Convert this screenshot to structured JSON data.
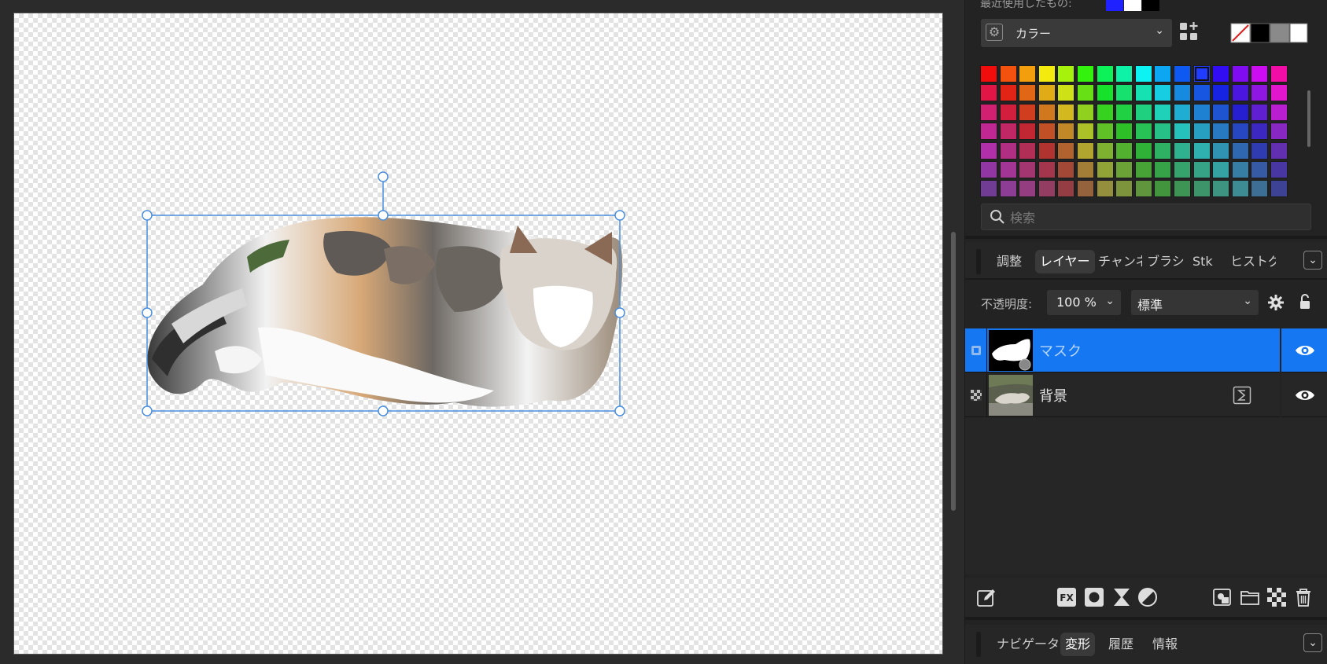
{
  "panel": {
    "recent_label": "最近使用したもの:",
    "recent_colors": [
      "#1f22ff",
      "#ffffff",
      "#000000"
    ],
    "palette_select_label": "カラー",
    "fg_bg_colors": [
      "#ffffff",
      "#000000",
      "#8a8a8a",
      "#ffffff"
    ],
    "search_placeholder": "検索",
    "selected_color": "#1f3cff"
  },
  "tabs_top": [
    "調整",
    "レイヤー",
    "チャンネル",
    "ブラシ",
    "Stk",
    "ヒストグラム"
  ],
  "tabs_top_active": "レイヤー",
  "opacity": {
    "label": "不透明度:",
    "value": "100 %",
    "blend_mode": "標準"
  },
  "layers": [
    {
      "name": "マスク",
      "selected": true,
      "visible": true
    },
    {
      "name": "背景",
      "selected": false,
      "visible": true
    }
  ],
  "tabs_bottom": [
    "ナビゲータ",
    "変形",
    "履歴",
    "情報"
  ],
  "tabs_bottom_active": "変形",
  "icons": {
    "collapse": "chevron-down-icon",
    "eye": "eye-icon",
    "gear": "gear-icon",
    "lock": "lock-icon",
    "search": "search-icon"
  }
}
